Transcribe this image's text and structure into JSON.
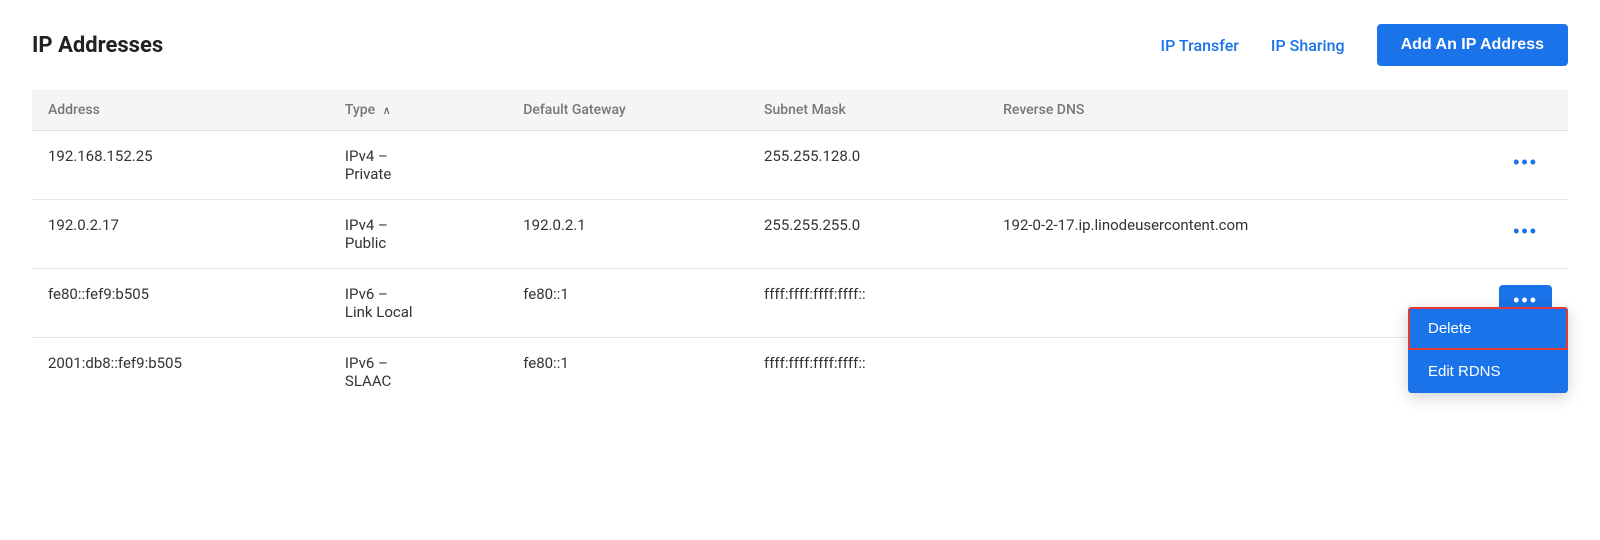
{
  "header": {
    "title": "IP Addresses",
    "ip_transfer_label": "IP Transfer",
    "ip_sharing_label": "IP Sharing",
    "add_button_label": "Add An IP Address"
  },
  "table": {
    "columns": [
      {
        "id": "address",
        "label": "Address",
        "sortable": false
      },
      {
        "id": "type",
        "label": "Type",
        "sortable": true
      },
      {
        "id": "default_gateway",
        "label": "Default Gateway",
        "sortable": false
      },
      {
        "id": "subnet_mask",
        "label": "Subnet Mask",
        "sortable": false
      },
      {
        "id": "reverse_dns",
        "label": "Reverse DNS",
        "sortable": false
      }
    ],
    "rows": [
      {
        "address": "192.168.152.25",
        "type": "IPv4 – Private",
        "default_gateway": "",
        "subnet_mask": "255.255.128.0",
        "reverse_dns": "",
        "has_dropdown": false,
        "dropdown_open": false
      },
      {
        "address": "192.0.2.17",
        "type": "IPv4 – Public",
        "default_gateway": "192.0.2.1",
        "subnet_mask": "255.255.255.0",
        "reverse_dns": "192-0-2-17.ip.linodeusercontent.com",
        "has_dropdown": false,
        "dropdown_open": false
      },
      {
        "address": "fe80::fef9:b505",
        "type": "IPv6 – Link Local",
        "default_gateway": "fe80::1",
        "subnet_mask": "ffff:ffff:ffff:ffff::",
        "reverse_dns": "",
        "has_dropdown": true,
        "dropdown_open": true
      },
      {
        "address": "2001:db8::fef9:b505",
        "type": "IPv6 – SLAAC",
        "default_gateway": "fe80::1",
        "subnet_mask": "ffff:ffff:ffff:ffff::",
        "reverse_dns": "",
        "has_dropdown": false,
        "dropdown_open": false
      }
    ],
    "dropdown_items": [
      {
        "id": "delete",
        "label": "Delete",
        "is_delete": true
      },
      {
        "id": "edit_rdns",
        "label": "Edit RDNS",
        "is_delete": false
      }
    ]
  },
  "icons": {
    "dots": "•••",
    "sort_asc": "∧"
  }
}
